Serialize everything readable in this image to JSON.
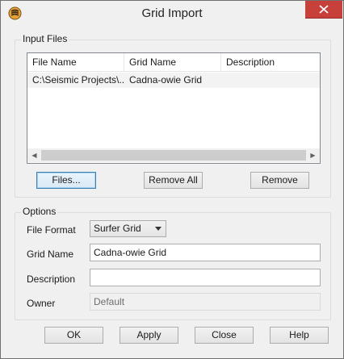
{
  "window": {
    "title": "Grid Import"
  },
  "input_files": {
    "group_label": "Input Files",
    "columns": [
      "File Name",
      "Grid Name",
      "Description"
    ],
    "rows": [
      {
        "file_name": "C:\\Seismic Projects\\...",
        "grid_name": "Cadna-owie Grid",
        "description": ""
      }
    ],
    "buttons": {
      "files": "Files...",
      "remove_all": "Remove All",
      "remove": "Remove"
    }
  },
  "options": {
    "group_label": "Options",
    "file_format_label": "File Format",
    "file_format_value": "Surfer Grid",
    "grid_name_label": "Grid Name",
    "grid_name_value": "Cadna-owie Grid",
    "description_label": "Description",
    "description_value": "",
    "owner_label": "Owner",
    "owner_value": "Default"
  },
  "footer": {
    "ok": "OK",
    "apply": "Apply",
    "close": "Close",
    "help": "Help"
  },
  "icons": {
    "app": "app-logo-icon",
    "close": "close-icon",
    "scroll_left": "scroll-left-icon",
    "scroll_right": "scroll-right-icon",
    "dropdown": "chevron-down-icon"
  },
  "colors": {
    "close_button": "#c7403a",
    "default_button_border": "#3c7fb1",
    "window_background": "#f0f0f0"
  }
}
